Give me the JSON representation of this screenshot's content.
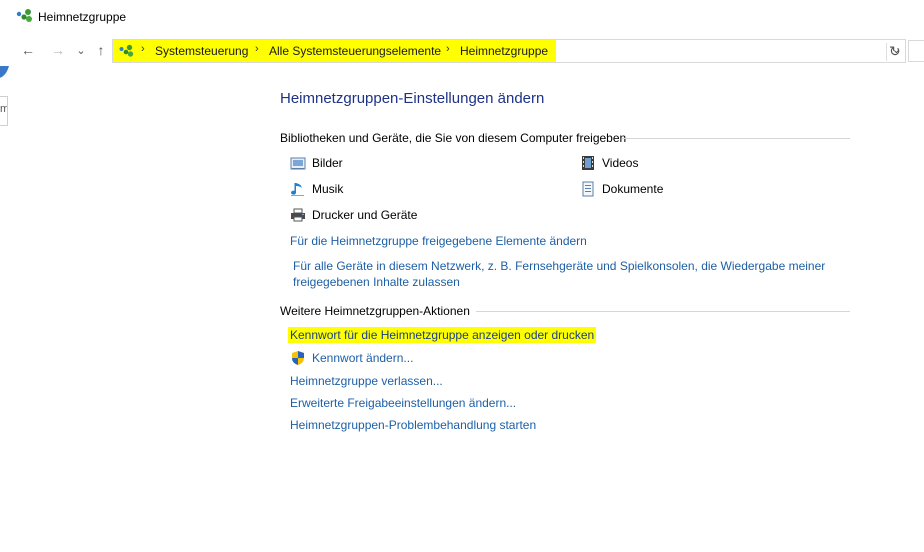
{
  "window": {
    "title": "Heimnetzgruppe"
  },
  "nav": {
    "back": "←",
    "forward": "→",
    "recent": "⌄",
    "up": "↑",
    "refresh": "↻",
    "dropdown": "⌄"
  },
  "breadcrumb": {
    "separator": "›",
    "items": [
      "Systemsteuerung",
      "Alle Systemsteuerungselemente",
      "Heimnetzgruppe"
    ]
  },
  "main": {
    "heading": "Heimnetzgruppen-Einstellungen ändern",
    "shared_section": {
      "title": "Bibliotheken und Geräte, die Sie von diesem Computer freigeben",
      "items": [
        {
          "label": "Bilder",
          "icon": "pictures-icon"
        },
        {
          "label": "Videos",
          "icon": "videos-icon"
        },
        {
          "label": "Musik",
          "icon": "music-icon"
        },
        {
          "label": "Dokumente",
          "icon": "documents-icon"
        },
        {
          "label": "Drucker und Geräte",
          "icon": "printer-icon"
        }
      ],
      "links": [
        "Für die Heimnetzgruppe freigegebene Elemente ändern",
        "Für alle Geräte in diesem Netzwerk, z. B. Fernsehgeräte und Spielkonsolen, die Wiedergabe meiner freigegebenen Inhalte zulassen"
      ]
    },
    "actions_section": {
      "title": "Weitere Heimnetzgruppen-Aktionen",
      "links": [
        "Kennwort für die Heimnetzgruppe anzeigen oder drucken",
        "Kennwort ändern...",
        "Heimnetzgruppe verlassen...",
        "Erweiterte Freigabeeinstellungen ändern...",
        "Heimnetzgruppen-Problembehandlung starten"
      ]
    }
  },
  "colors": {
    "highlight": "#ffff00",
    "link": "#1d5fa6",
    "heading": "#1e3287"
  }
}
